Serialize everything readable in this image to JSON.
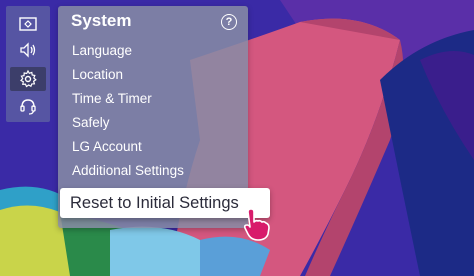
{
  "sidebar": {
    "icons": [
      {
        "name": "picture-icon",
        "active": false
      },
      {
        "name": "sound-icon",
        "active": false
      },
      {
        "name": "settings-gear-icon",
        "active": true
      },
      {
        "name": "support-headset-icon",
        "active": false
      }
    ]
  },
  "panel": {
    "title": "System",
    "help_glyph": "?",
    "items": [
      {
        "label": "Language"
      },
      {
        "label": "Location"
      },
      {
        "label": "Time & Timer"
      },
      {
        "label": "Safely"
      },
      {
        "label": "LG Account"
      },
      {
        "label": "Additional Settings"
      },
      {
        "label": "Reset to Initial Settings",
        "highlighted": true
      }
    ]
  },
  "colors": {
    "accent": "#d81b6b",
    "background_base": "#3a2aa6",
    "highlight_bg": "#ffffff"
  }
}
